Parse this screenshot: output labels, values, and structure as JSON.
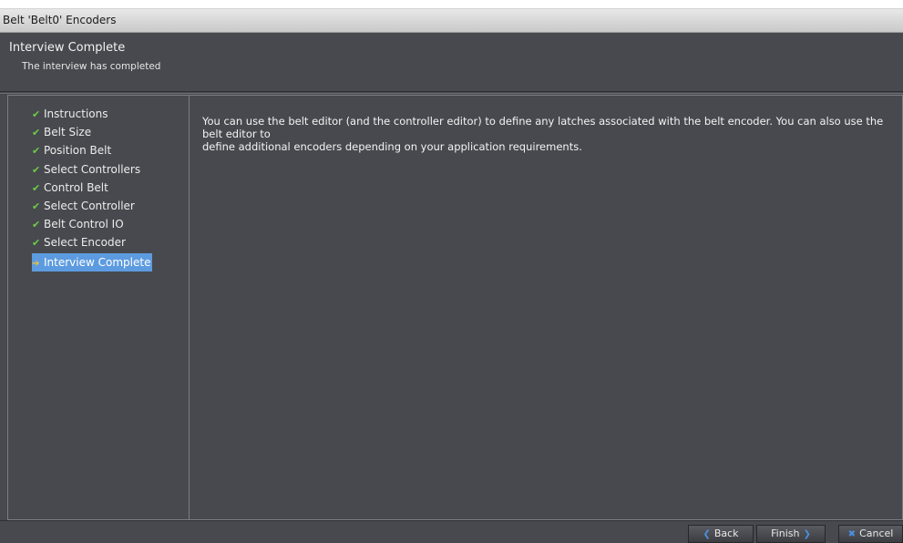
{
  "window": {
    "title": "Belt 'Belt0' Encoders"
  },
  "header": {
    "title": "Interview Complete",
    "subtitle": "The interview has completed"
  },
  "steps": [
    {
      "label": "Instructions",
      "status": "done"
    },
    {
      "label": "Belt Size",
      "status": "done"
    },
    {
      "label": "Position Belt",
      "status": "done"
    },
    {
      "label": "Select Controllers",
      "status": "done"
    },
    {
      "label": "Control Belt",
      "status": "done"
    },
    {
      "label": "Select Controller",
      "status": "done"
    },
    {
      "label": "Belt Control IO",
      "status": "done"
    },
    {
      "label": "Select Encoder",
      "status": "done"
    },
    {
      "label": "Interview Complete",
      "status": "current"
    }
  ],
  "content": {
    "text": "You can use the belt editor (and the controller editor) to define any latches associated with the belt encoder.  You can also use the belt editor to\ndefine additional encoders depending on your application requirements."
  },
  "footer": {
    "back_label": "Back",
    "finish_label": "Finish",
    "cancel_label": "Cancel"
  },
  "colors": {
    "background": "#48494f",
    "check": "#6bcc47",
    "current_highlight": "#5d9be0",
    "current_arrow": "#f0c232"
  },
  "icons": {
    "done": "check-icon",
    "current": "arrow-right-icon",
    "back": "chevron-left-icon",
    "finish": "chevron-right-icon",
    "cancel": "close-icon"
  }
}
